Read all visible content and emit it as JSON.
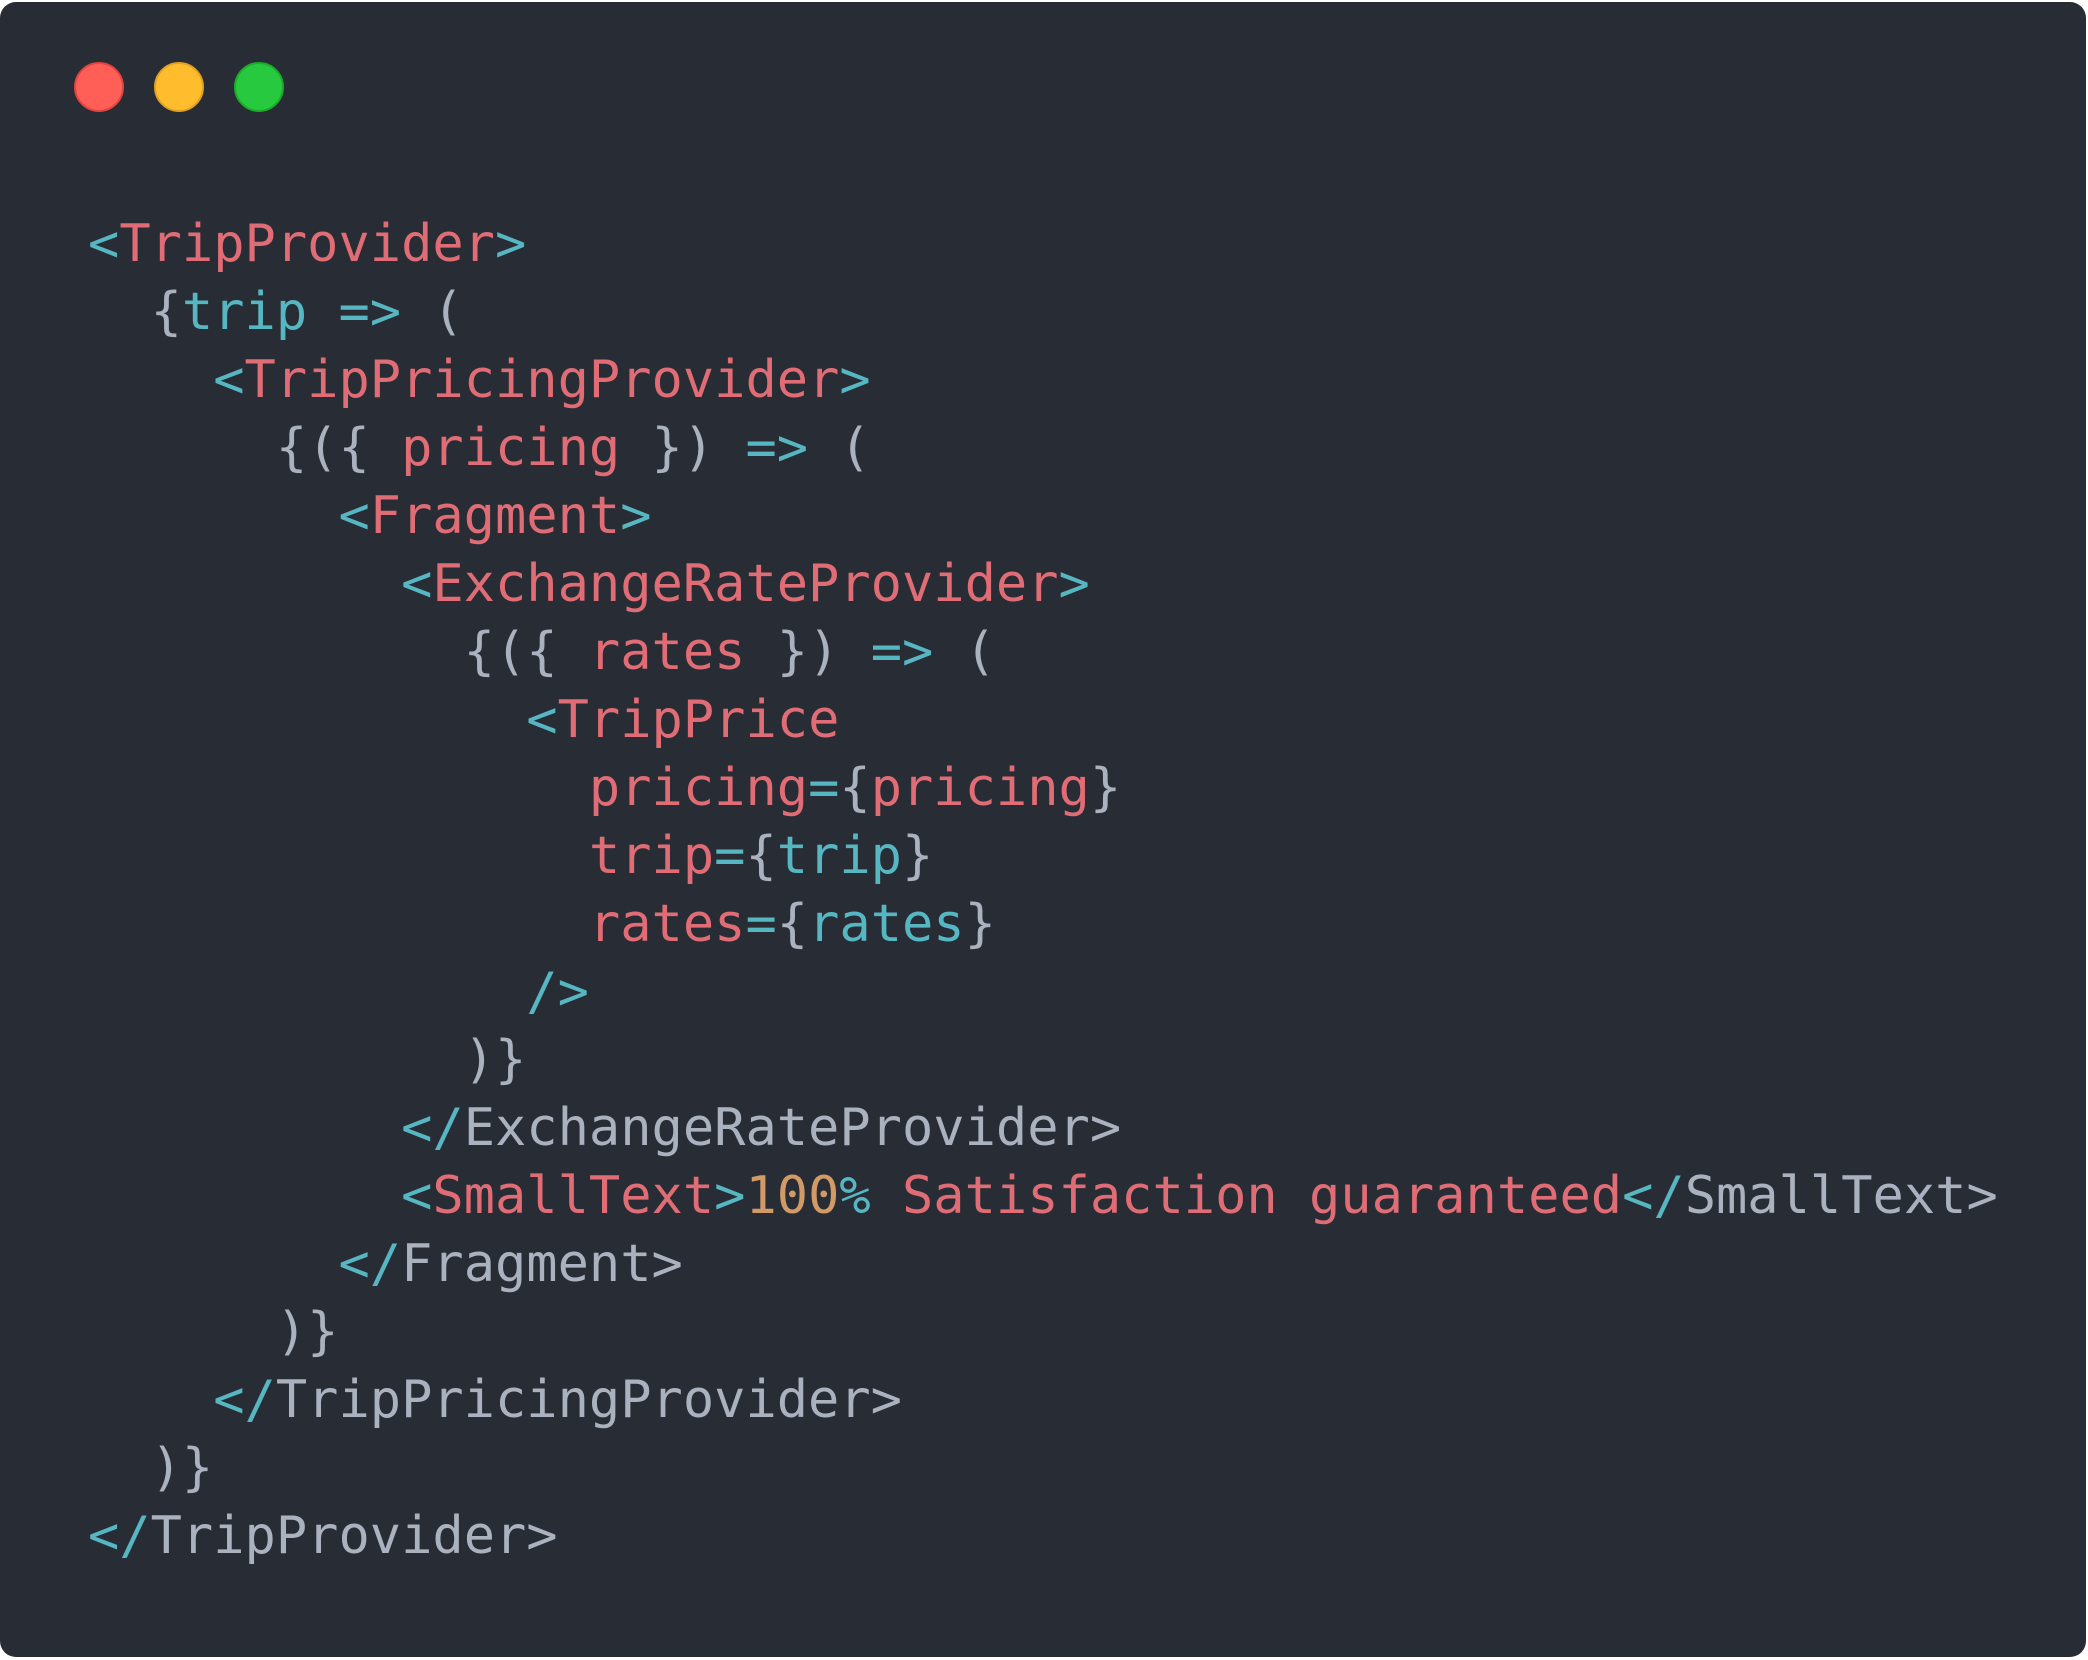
{
  "window": {
    "controls": [
      "close",
      "minimize",
      "maximize"
    ],
    "colors": {
      "background": "#282c34",
      "close": "#ff5f56",
      "minimize": "#ffbd2e",
      "maximize": "#27c93f"
    }
  },
  "code": {
    "language": "jsx",
    "lines": [
      [
        {
          "c": "p",
          "v": "<"
        },
        {
          "c": "t",
          "v": "TripProvider"
        },
        {
          "c": "p",
          "v": ">"
        }
      ],
      [
        {
          "c": "d",
          "v": "  {"
        },
        {
          "c": "p",
          "v": "trip => "
        },
        {
          "c": "d",
          "v": "("
        }
      ],
      [
        {
          "c": "p",
          "v": "    <"
        },
        {
          "c": "t",
          "v": "TripPricingProvider"
        },
        {
          "c": "p",
          "v": ">"
        }
      ],
      [
        {
          "c": "d",
          "v": "      {({ "
        },
        {
          "c": "t",
          "v": "pricing"
        },
        {
          "c": "d",
          "v": " }) "
        },
        {
          "c": "p",
          "v": "=>"
        },
        {
          "c": "d",
          "v": " ("
        }
      ],
      [
        {
          "c": "p",
          "v": "        <"
        },
        {
          "c": "t",
          "v": "Fragment"
        },
        {
          "c": "p",
          "v": ">"
        }
      ],
      [
        {
          "c": "p",
          "v": "          <"
        },
        {
          "c": "t",
          "v": "ExchangeRateProvider"
        },
        {
          "c": "p",
          "v": ">"
        }
      ],
      [
        {
          "c": "d",
          "v": "            {({ "
        },
        {
          "c": "t",
          "v": "rates"
        },
        {
          "c": "d",
          "v": " }) "
        },
        {
          "c": "p",
          "v": "=>"
        },
        {
          "c": "d",
          "v": " ("
        }
      ],
      [
        {
          "c": "p",
          "v": "              <"
        },
        {
          "c": "t",
          "v": "TripPrice"
        }
      ],
      [
        {
          "c": "t",
          "v": "                pricing"
        },
        {
          "c": "p",
          "v": "="
        },
        {
          "c": "d",
          "v": "{"
        },
        {
          "c": "t",
          "v": "pricing"
        },
        {
          "c": "d",
          "v": "}"
        }
      ],
      [
        {
          "c": "t",
          "v": "                trip"
        },
        {
          "c": "p",
          "v": "="
        },
        {
          "c": "d",
          "v": "{"
        },
        {
          "c": "p",
          "v": "trip"
        },
        {
          "c": "d",
          "v": "}"
        }
      ],
      [
        {
          "c": "t",
          "v": "                rates"
        },
        {
          "c": "p",
          "v": "="
        },
        {
          "c": "d",
          "v": "{"
        },
        {
          "c": "p",
          "v": "rates"
        },
        {
          "c": "d",
          "v": "}"
        }
      ],
      [
        {
          "c": "p",
          "v": "              />"
        }
      ],
      [
        {
          "c": "d",
          "v": "            )}"
        }
      ],
      [
        {
          "c": "p",
          "v": "          </"
        },
        {
          "c": "d",
          "v": "ExchangeRateProvider>"
        }
      ],
      [
        {
          "c": "p",
          "v": "          <"
        },
        {
          "c": "t",
          "v": "SmallText"
        },
        {
          "c": "p",
          "v": ">"
        },
        {
          "c": "n",
          "v": "100"
        },
        {
          "c": "p",
          "v": "% "
        },
        {
          "c": "t",
          "v": "Satisfaction guaranteed"
        },
        {
          "c": "p",
          "v": "</"
        },
        {
          "c": "d",
          "v": "SmallText>"
        }
      ],
      [
        {
          "c": "p",
          "v": "        </"
        },
        {
          "c": "d",
          "v": "Fragment>"
        }
      ],
      [
        {
          "c": "d",
          "v": "      )}"
        }
      ],
      [
        {
          "c": "p",
          "v": "    </"
        },
        {
          "c": "d",
          "v": "TripPricingProvider>"
        }
      ],
      [
        {
          "c": "d",
          "v": "  )}"
        }
      ],
      [
        {
          "c": "p",
          "v": "</"
        },
        {
          "c": "d",
          "v": "TripProvider>"
        }
      ]
    ]
  }
}
